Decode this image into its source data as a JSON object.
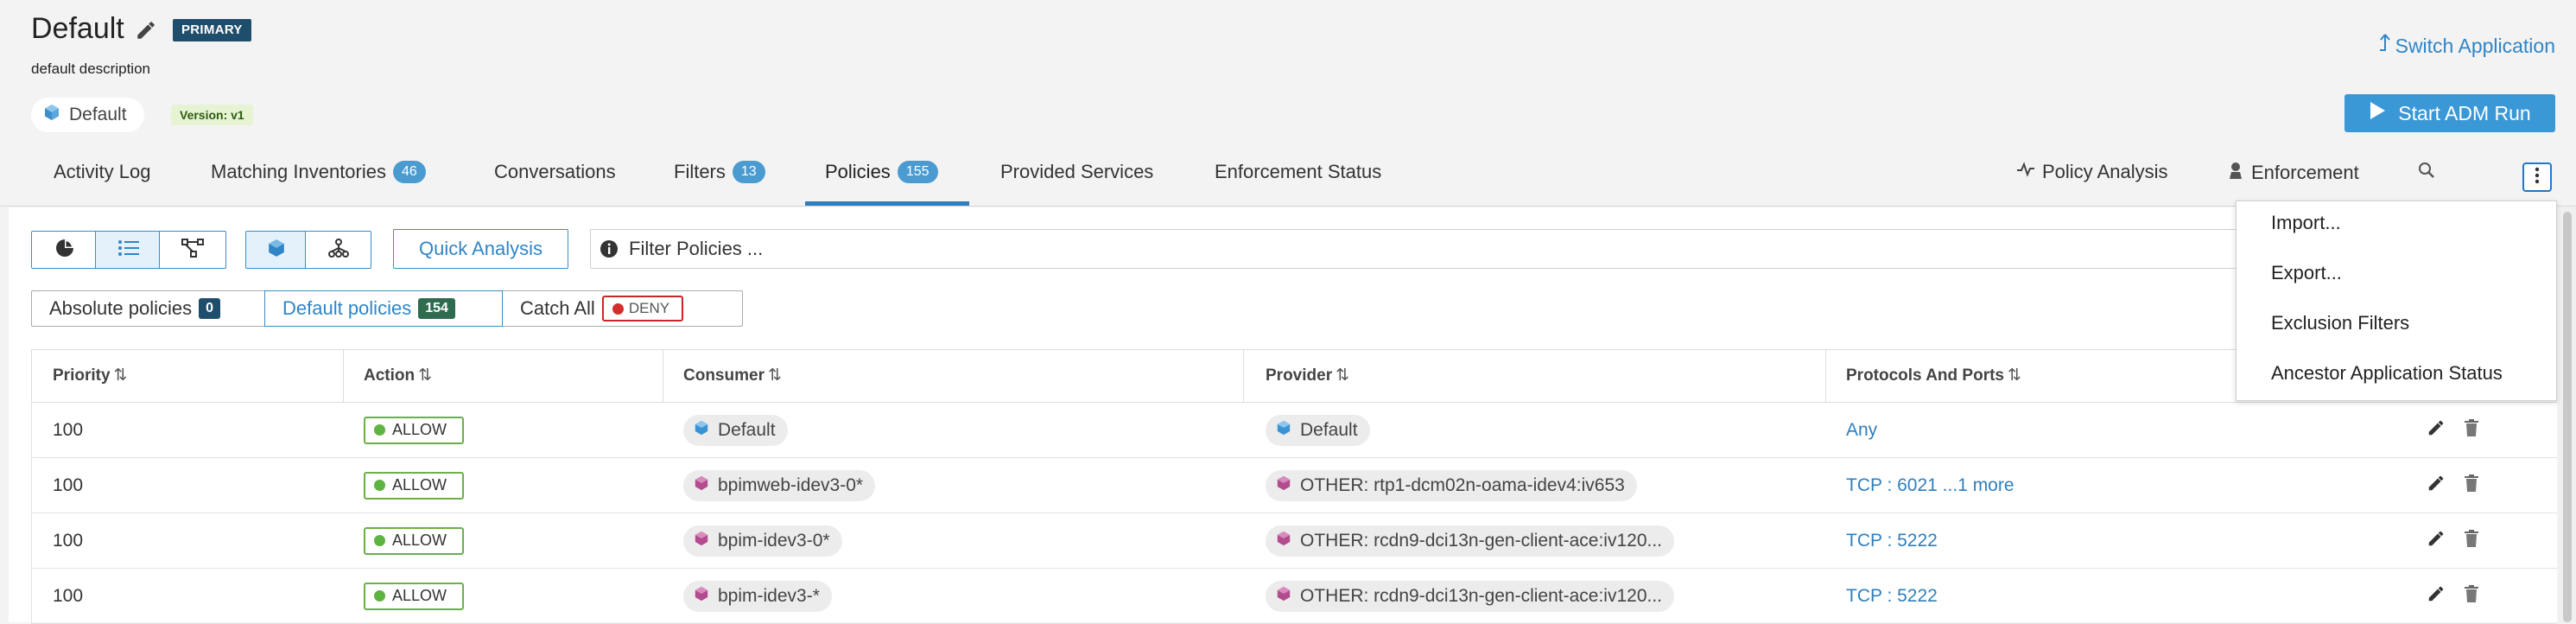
{
  "header": {
    "title": "Default",
    "primary_badge": "PRIMARY",
    "description": "default description",
    "scope_chip": "Default",
    "version_badge": "Version: v1",
    "switch_application": "Switch Application",
    "start_adm_run": "Start ADM Run"
  },
  "tabs": [
    {
      "label": "Activity Log"
    },
    {
      "label": "Matching Inventories",
      "count": "46"
    },
    {
      "label": "Conversations"
    },
    {
      "label": "Filters",
      "count": "13"
    },
    {
      "label": "Policies",
      "count": "155",
      "active": true
    },
    {
      "label": "Provided Services"
    },
    {
      "label": "Enforcement Status"
    }
  ],
  "right_tools": {
    "policy_analysis": "Policy Analysis",
    "enforcement": "Enforcement"
  },
  "toolbar": {
    "quick_analysis": "Quick Analysis",
    "filter_placeholder": "Filter Policies ..."
  },
  "policy_segments": {
    "absolute_label": "Absolute policies",
    "absolute_count": "0",
    "default_label": "Default policies",
    "default_count": "154",
    "catch_all_label": "Catch All",
    "catch_all_value": "DENY"
  },
  "table": {
    "columns": [
      "Priority",
      "Action",
      "Consumer",
      "Provider",
      "Protocols And Ports"
    ],
    "rows": [
      {
        "priority": "100",
        "action": "ALLOW",
        "consumer": "Default",
        "provider": "Default",
        "ports": "Any"
      },
      {
        "priority": "100",
        "action": "ALLOW",
        "consumer": "bpimweb-idev3-0*",
        "provider": "OTHER: rtp1-dcm02n-oama-idev4:iv653",
        "ports": "TCP : 6021 ...1 more"
      },
      {
        "priority": "100",
        "action": "ALLOW",
        "consumer": "bpim-idev3-0*",
        "provider": "OTHER: rcdn9-dci13n-gen-client-ace:iv120...",
        "ports": "TCP : 5222"
      },
      {
        "priority": "100",
        "action": "ALLOW",
        "consumer": "bpim-idev3-*",
        "provider": "OTHER: rcdn9-dci13n-gen-client-ace:iv120...",
        "ports": "TCP : 5222"
      }
    ]
  },
  "more_menu": {
    "items": [
      "Import...",
      "Export...",
      "Exclusion Filters",
      "Ancestor Application Status"
    ]
  },
  "colors": {
    "accent": "#2f85c7",
    "primary_badge": "#1f4e6c",
    "allow_green": "#5fb341",
    "deny_red": "#d32f2f"
  },
  "icons": {
    "edit": "pencil-icon",
    "scope": "cube-icon",
    "switch": "arrow-up-icon",
    "play": "play-icon",
    "search": "search-icon",
    "more": "more-vertical-icon",
    "delete": "trash-icon"
  }
}
